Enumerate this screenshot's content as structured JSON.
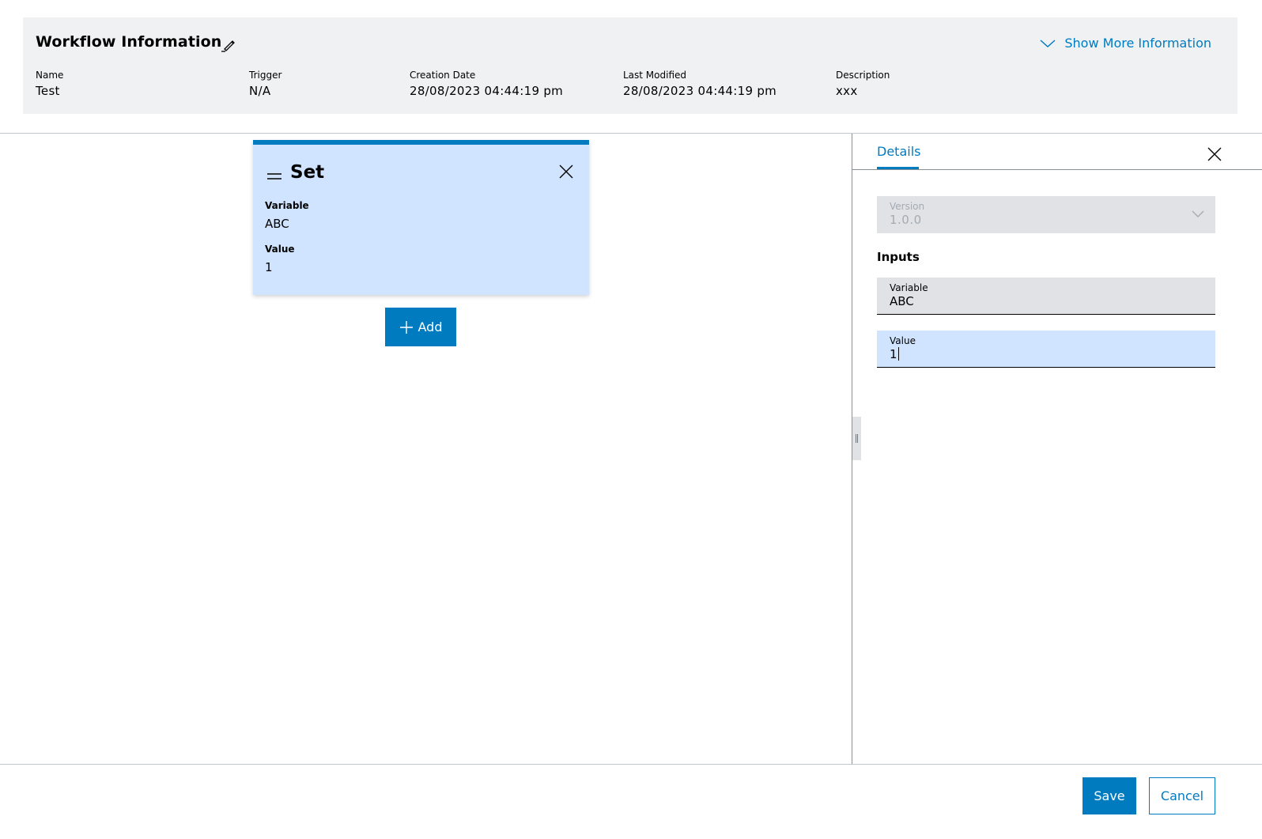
{
  "workflow_info": {
    "title": "Workflow Information",
    "show_more_label": "Show More Information",
    "fields": {
      "name": {
        "label": "Name",
        "value": "Test"
      },
      "trigger": {
        "label": "Trigger",
        "value": "N/A"
      },
      "creation_date": {
        "label": "Creation Date",
        "value": "28/08/2023 04:44:19 pm"
      },
      "last_modified": {
        "label": "Last Modified",
        "value": "28/08/2023 04:44:19 pm"
      },
      "description": {
        "label": "Description",
        "value": "xxx"
      }
    }
  },
  "canvas": {
    "set_card": {
      "title": "Set",
      "variable_label": "Variable",
      "variable_value": "ABC",
      "value_label": "Value",
      "value_value": "1"
    },
    "add_button_label": "Add"
  },
  "details_panel": {
    "tab_label": "Details",
    "version": {
      "label": "Version",
      "value": "1.0.0"
    },
    "inputs_heading": "Inputs",
    "variable_field": {
      "label": "Variable",
      "value": "ABC"
    },
    "value_field": {
      "label": "Value",
      "value": "1"
    }
  },
  "footer": {
    "save_label": "Save",
    "cancel_label": "Cancel"
  },
  "colors": {
    "accent": "#007bc0",
    "panel_bg": "#eff1f2",
    "card_bg": "#d1e4ff",
    "field_bg": "#e0e2e5"
  }
}
